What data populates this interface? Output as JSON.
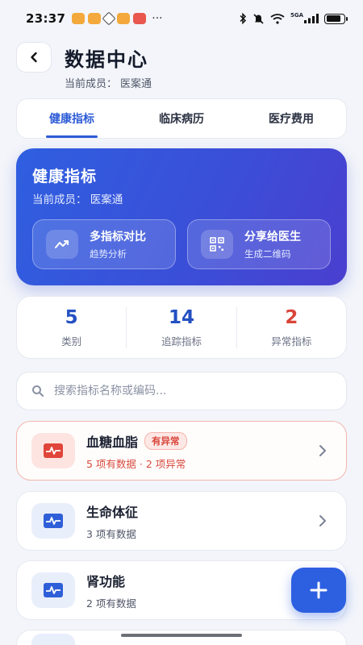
{
  "status_bar": {
    "time": "23:37",
    "more": "···",
    "signal_label": "5GA"
  },
  "header": {
    "title": "数据中心",
    "member_label": "当前成员：",
    "member_name": "医案通"
  },
  "tabs": [
    {
      "label": "健康指标",
      "active": true
    },
    {
      "label": "临床病历",
      "active": false
    },
    {
      "label": "医疗费用",
      "active": false
    }
  ],
  "hero": {
    "title": "健康指标",
    "member": "当前成员： 医案通",
    "actions": [
      {
        "label": "多指标对比",
        "desc": "趋势分析",
        "icon": "trend-icon"
      },
      {
        "label": "分享给医生",
        "desc": "生成二维码",
        "icon": "qr-code-icon"
      }
    ]
  },
  "stats": [
    {
      "value": "5",
      "label": "类别",
      "color": "#2450c2"
    },
    {
      "value": "14",
      "label": "追踪指标",
      "color": "#2450c2"
    },
    {
      "value": "2",
      "label": "异常指标",
      "color": "#d9453a"
    }
  ],
  "search": {
    "placeholder": "搜索指标名称或编码..."
  },
  "categories": [
    {
      "name": "血糖血脂",
      "badge": "有异常",
      "meta": "5 项有数据 · 2 项异常",
      "alert": true
    },
    {
      "name": "生命体征",
      "badge": "",
      "meta": "3 项有数据",
      "alert": false
    },
    {
      "name": "肾功能",
      "badge": "",
      "meta": "2 项有数据",
      "alert": false
    }
  ],
  "colors": {
    "primary": "#2d5fe1",
    "alert": "#d9453a",
    "background": "#f3f5fa"
  }
}
